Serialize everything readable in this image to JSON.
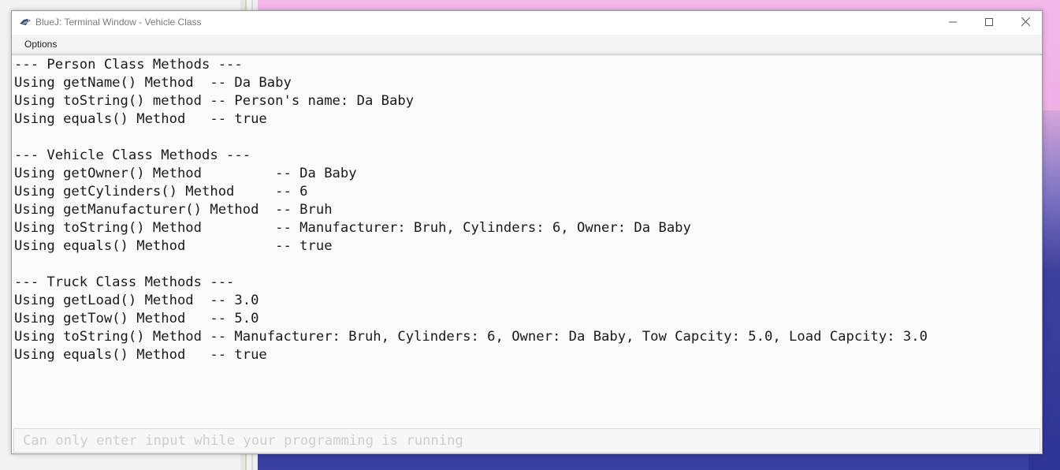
{
  "window": {
    "title": "BlueJ: Terminal Window - Vehicle Class",
    "icon": "bluej-bird-icon",
    "controls": {
      "minimize": "minimize-icon",
      "maximize": "maximize-icon",
      "close": "close-icon"
    }
  },
  "menu": {
    "options_label": "Options"
  },
  "output": {
    "lines": [
      "--- Person Class Methods ---",
      "Using getName() Method  -- Da Baby",
      "Using toString() method -- Person's name: Da Baby",
      "Using equals() Method   -- true",
      "",
      "--- Vehicle Class Methods ---",
      "Using getOwner() Method         -- Da Baby",
      "Using getCylinders() Method     -- 6",
      "Using getManufacturer() Method  -- Bruh",
      "Using toString() Method         -- Manufacturer: Bruh, Cylinders: 6, Owner: Da Baby",
      "Using equals() Method           -- true",
      "",
      "--- Truck Class Methods ---",
      "Using getLoad() Method  -- 3.0",
      "Using getTow() Method   -- 5.0",
      "Using toString() Method -- Manufacturer: Bruh, Cylinders: 6, Owner: Da Baby, Tow Capcity: 5.0, Load Capcity: 3.0",
      "Using equals() Method   -- true"
    ]
  },
  "input": {
    "placeholder": "Can only enter input while your programming is running",
    "value": ""
  },
  "colors": {
    "window_bg": "#fafafa",
    "text": "#1a1a1a",
    "placeholder": "#cdcdcd",
    "wallpaper_top": "#f3b7ea",
    "wallpaper_bottom": "#2b3190"
  }
}
